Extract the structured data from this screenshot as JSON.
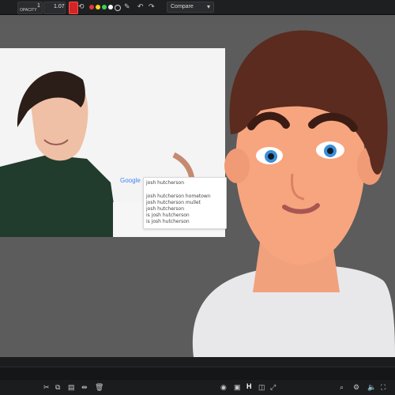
{
  "toolbar": {
    "opacity_label": "OPACITY",
    "opacity_value": "1",
    "size_value": "1.07",
    "compare_select": "Compare",
    "colors": [
      "#e53935",
      "#f9d423",
      "#3bd15c",
      "#ffffff"
    ],
    "icons": [
      "record-icon",
      "sync-icon",
      "brush-icon",
      "undo-icon",
      "redo-icon"
    ]
  },
  "photo": {
    "google_label": "Google",
    "search_query": "josh hutcherson",
    "suggestions": [
      "josh hutcherson hometown",
      "josh hutcherson mullet",
      "josh hutcherson",
      "is josh hutcherson",
      "is josh hutcherson"
    ]
  },
  "bottom_icons": {
    "left": [
      "scissors-icon",
      "copy-icon",
      "paste-icon",
      "split-icon",
      "trash-icon"
    ],
    "right": [
      "hide-icon",
      "layers-icon",
      "h-icon",
      "group-icon",
      "export-icon",
      "zoom-icon",
      "settings-icon",
      "volume-icon",
      "fullscreen-icon"
    ]
  }
}
